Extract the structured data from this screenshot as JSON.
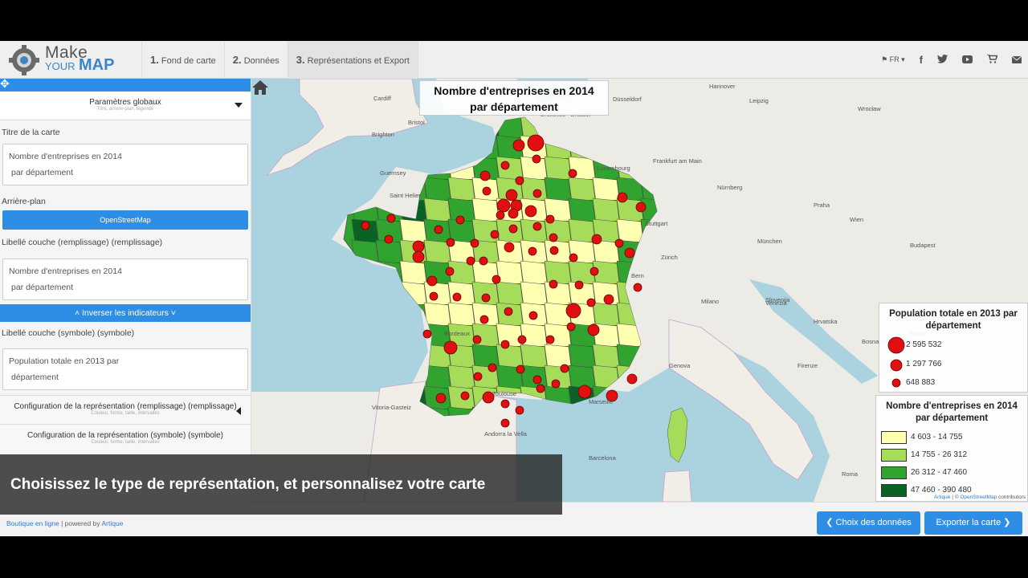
{
  "logo": {
    "make": "Make",
    "your": "YOUR",
    "map": "MAP"
  },
  "tabs": [
    {
      "num": "1.",
      "label": "Fond de carte"
    },
    {
      "num": "2.",
      "label": "Données"
    },
    {
      "num": "3.",
      "label": "Représentations et Export"
    }
  ],
  "header_right": {
    "lang": "FR"
  },
  "sidebar": {
    "global_params": "Paramètres globaux",
    "global_params_sub": "Titre, arrière-plan, légende",
    "map_title_label": "Titre de la carte",
    "map_title_value": [
      "Nombre d'entreprises en 2014",
      "par département"
    ],
    "background_label": "Arrière-plan",
    "background_value": "OpenStreetMap",
    "fill_layer_label": "Libellé couche (remplissage) (remplissage)",
    "fill_layer_value": [
      "Nombre d'entreprises en 2014",
      "par département"
    ],
    "invert_label": "Inverser les indicateurs",
    "symbol_layer_label": "Libellé couche (symbole) (symbole)",
    "symbol_layer_value": [
      "Population totale en 2013 par",
      "département"
    ],
    "config_fill": "Configuration de la représentation (remplissage) (remplissage)",
    "config_fill_sub": "Couleur, forme, taille, intervalles",
    "config_symbol": "Configuration de la représentation (symbole) (symbole)",
    "config_symbol_sub": "Couleur, forme, taille, intervalles"
  },
  "map": {
    "title": [
      "Nombre d'entreprises en 2014",
      "par département"
    ],
    "legend_symbol": {
      "title": [
        "Population totale en 2013 par",
        "département"
      ],
      "items": [
        "2 595 532",
        "1 297 766",
        "648 883"
      ]
    },
    "legend_fill": {
      "title": [
        "Nombre d'entreprises en 2014",
        "par département"
      ],
      "items": [
        {
          "label": "4 603 - 14 755",
          "color": "#ffffb2"
        },
        {
          "label": "14 755 - 26 312",
          "color": "#a6dc5a"
        },
        {
          "label": "26 312 - 47 460",
          "color": "#31a32f"
        },
        {
          "label": "47 460 - 390 480",
          "color": "#0a6324"
        }
      ]
    },
    "attribution": {
      "artique": "Artique",
      "sep": " | © ",
      "osm": "OpenStreetMap",
      "rest": " contributors"
    },
    "place_labels": [
      "Cardiff",
      "Bristol",
      "Brighton",
      "Guernsey",
      "Saint Helier",
      "Bruxelles - Brussel",
      "Düsseldorf",
      "Luxembourg",
      "Frankfurt am Main",
      "Nürnberg",
      "Stuttgart",
      "München",
      "Praha",
      "Wien",
      "Zürich",
      "Bern",
      "Milano",
      "Venezia",
      "Genova",
      "Firenze",
      "Roma",
      "Vitoria-Gasteiz",
      "Andorra la Vella",
      "Barcelona",
      "Budapest",
      "Slovenija",
      "Hrvatska",
      "Bosna i Hercegovina",
      "Srbija",
      "Leipzig",
      "Hannover",
      "Wrocław",
      "Bordeaux",
      "Toulouse",
      "Marseille"
    ],
    "colors": {
      "water": "#aad3df",
      "land": "#ecebe6",
      "marker": "#e01010"
    }
  },
  "footer": {
    "shop": "Boutique en ligne",
    "powered": " | powered by ",
    "artique": "Artique",
    "back_button": "Choix des données",
    "export_button": "Exporter la carte"
  },
  "overlay_caption": "Choisissez le type de représentation, et personnalisez votre carte"
}
